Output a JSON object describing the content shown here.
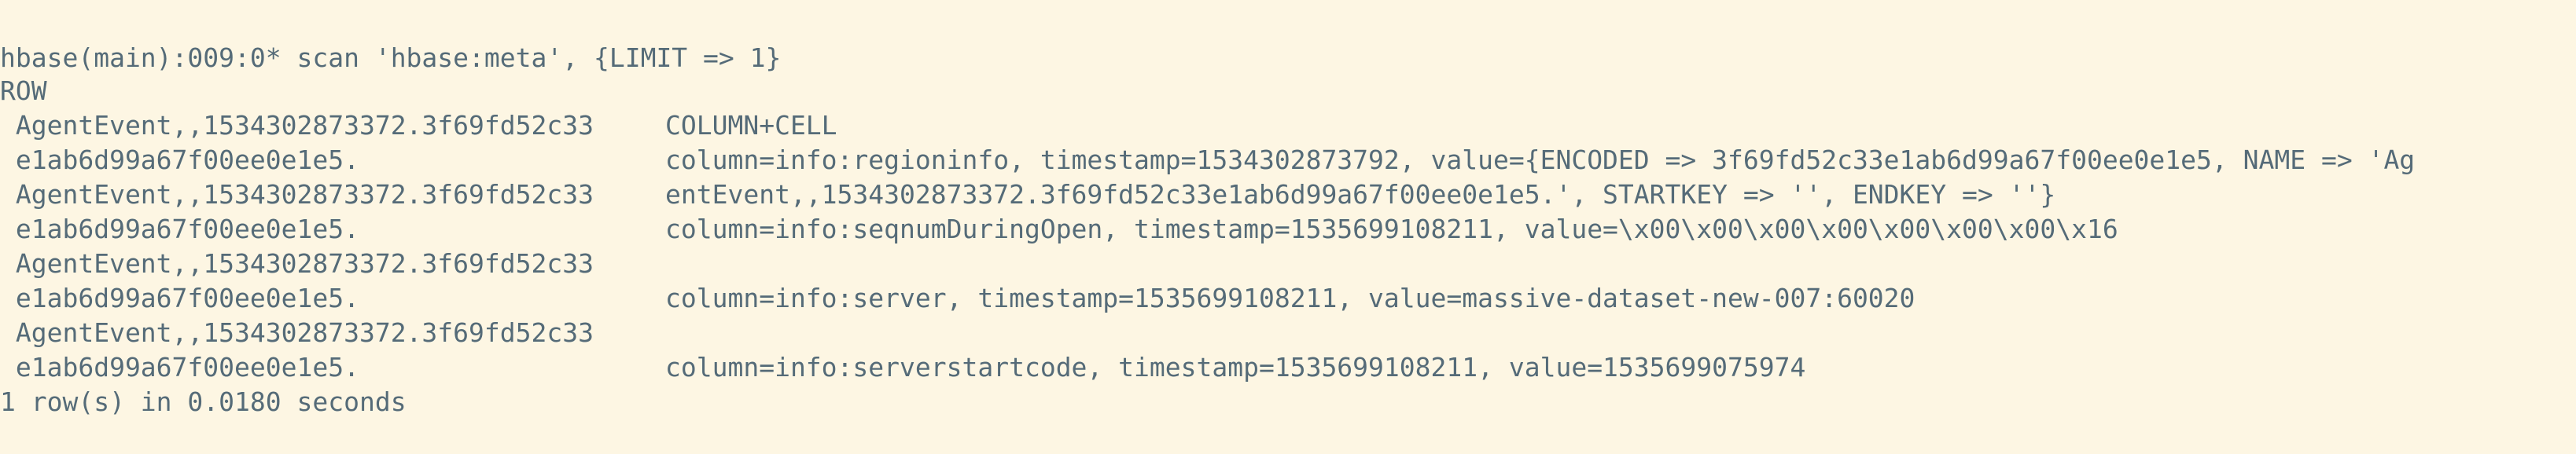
{
  "terminal": {
    "prompt_line": "hbase(main):009:0* scan 'hbase:meta', {LIMIT => 1}",
    "header": {
      "row": "ROW",
      "cell": "COLUMN+CELL"
    },
    "rows": [
      {
        "row_part1": " AgentEvent,,1534302873372.3f69fd52c33",
        "row_part2": " e1ab6d99a67f00ee0e1e5.",
        "cell_part1": "column=info:regioninfo, timestamp=1534302873792, value={ENCODED => 3f69fd52c33e1ab6d99a67f00ee0e1e5, NAME => 'Ag",
        "cell_part2": "entEvent,,1534302873372.3f69fd52c33e1ab6d99a67f00ee0e1e5.', STARTKEY => '', ENDKEY => ''}"
      },
      {
        "row_part1": " AgentEvent,,1534302873372.3f69fd52c33",
        "row_part2": " e1ab6d99a67f00ee0e1e5.",
        "cell_part1": "column=info:seqnumDuringOpen, timestamp=1535699108211, value=\\x00\\x00\\x00\\x00\\x00\\x00\\x00\\x16",
        "cell_part2": ""
      },
      {
        "row_part1": " AgentEvent,,1534302873372.3f69fd52c33",
        "row_part2": " e1ab6d99a67f00ee0e1e5.",
        "cell_part1": "column=info:server, timestamp=1535699108211, value=massive-dataset-new-007:60020",
        "cell_part2": ""
      },
      {
        "row_part1": " AgentEvent,,1534302873372.3f69fd52c33",
        "row_part2": " e1ab6d99a67f00ee0e1e5.",
        "cell_part1": "column=info:serverstartcode, timestamp=1535699108211, value=1535699075974",
        "cell_part2": ""
      }
    ],
    "summary": "1 row(s) in 0.0180 seconds"
  },
  "colors": {
    "background": "#fdf6e3",
    "text": "#556b78"
  }
}
